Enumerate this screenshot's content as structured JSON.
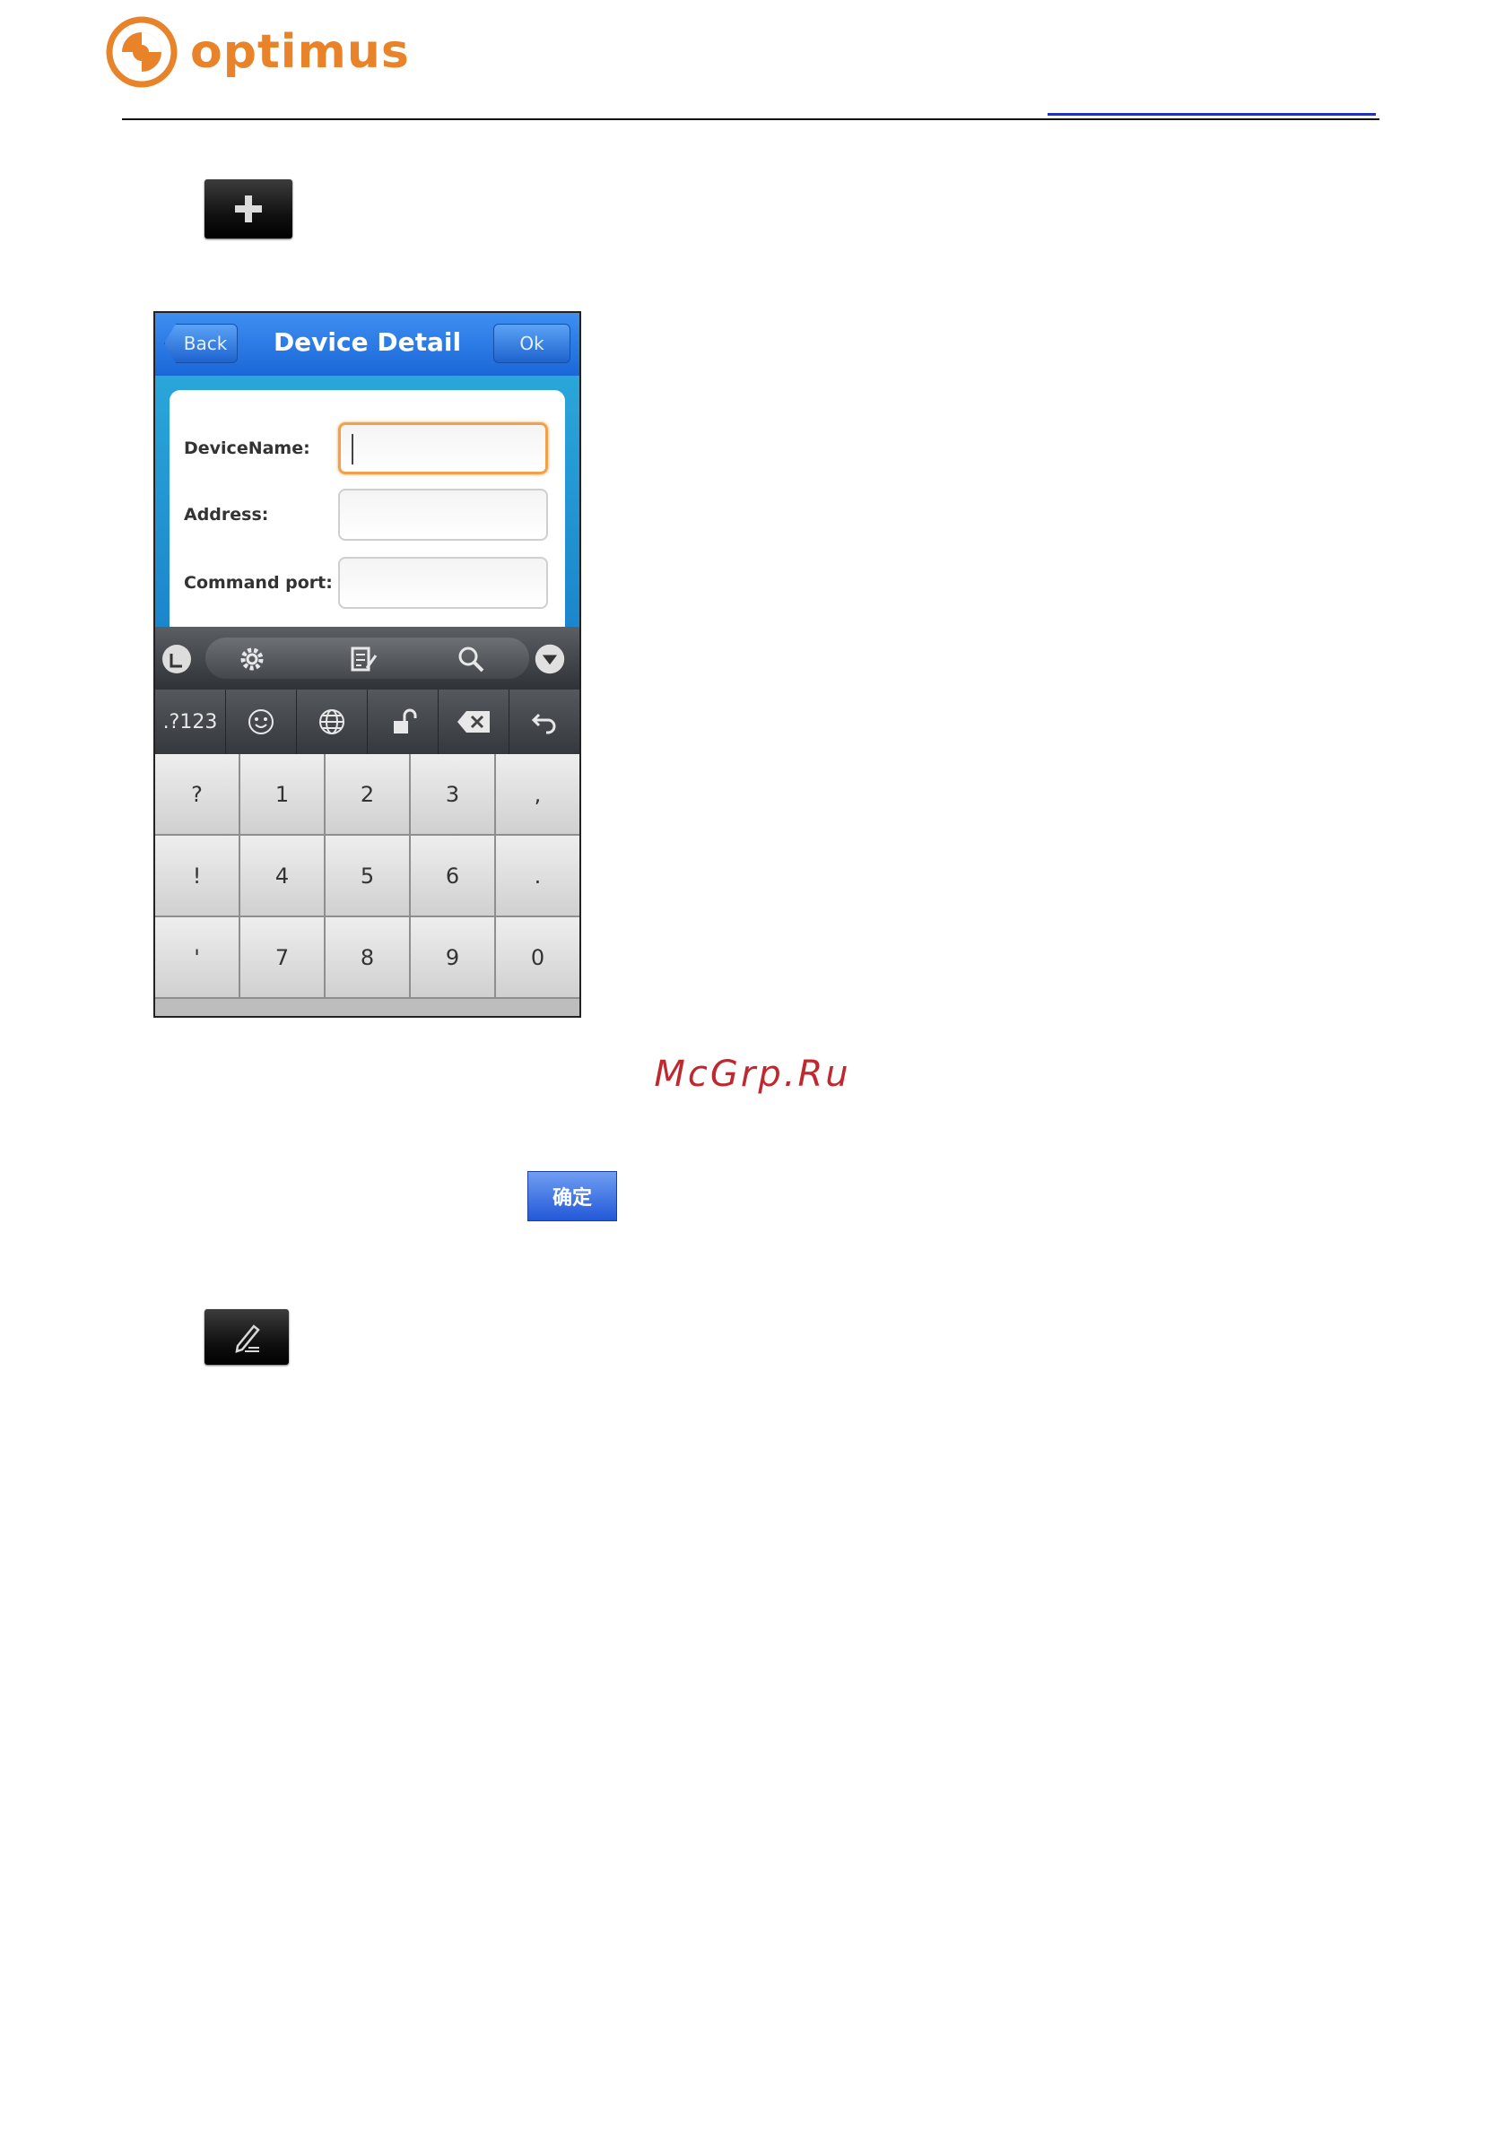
{
  "header": {
    "brand": "optimus",
    "brand_color": "#e8832a"
  },
  "icons": {
    "add": "plus-icon",
    "edit": "pencil-icon"
  },
  "phone": {
    "title": "Device Detail",
    "back_label": "Back",
    "ok_label": "Ok",
    "fields": [
      {
        "label": "DeviceName:",
        "value": ""
      },
      {
        "label": "Address:",
        "value": ""
      },
      {
        "label": "Command port:",
        "value": ""
      }
    ],
    "keyboard": {
      "mode_key": ".?123",
      "rows": [
        [
          "?",
          "1",
          "2",
          "3",
          ","
        ],
        [
          "!",
          "4",
          "5",
          "6",
          "."
        ],
        [
          "'",
          "7",
          "8",
          "9",
          "0"
        ]
      ]
    }
  },
  "watermark": "McGrp.Ru",
  "confirm_label": "确定"
}
